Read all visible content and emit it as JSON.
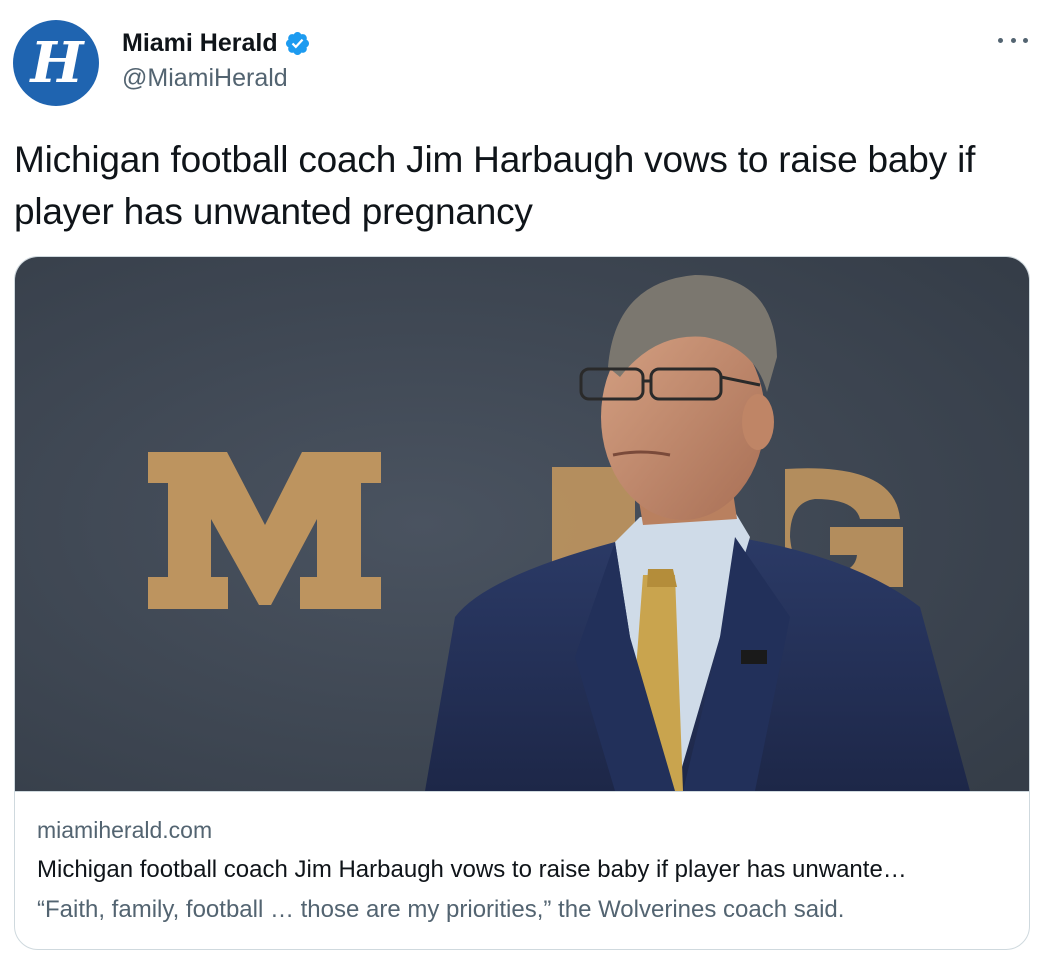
{
  "tweet": {
    "author": {
      "display_name": "Miami Herald",
      "handle": "@MiamiHerald",
      "avatar_letter": "H",
      "verified": true
    },
    "text": "Michigan football coach Jim Harbaugh vows to raise baby if player has unwanted pregnancy",
    "more_icon": "more-icon",
    "card": {
      "domain": "miamiherald.com",
      "title": "Michigan football coach Jim Harbaugh vows to raise baby if player has unwante…",
      "description": "“Faith, family, football … those are my priorities,” the Wolverines coach said.",
      "image_backdrop_letters": [
        "M",
        "B",
        "G"
      ]
    }
  },
  "colors": {
    "brand_blue": "#1f64b0",
    "verified_blue": "#1d9bf0",
    "text_primary": "#0f1419",
    "text_secondary": "#536471",
    "border": "#cfd9de",
    "backdrop_slate": "#3b4552",
    "block_letter_gold": "#c89a5f",
    "suit_navy": "#243258"
  }
}
